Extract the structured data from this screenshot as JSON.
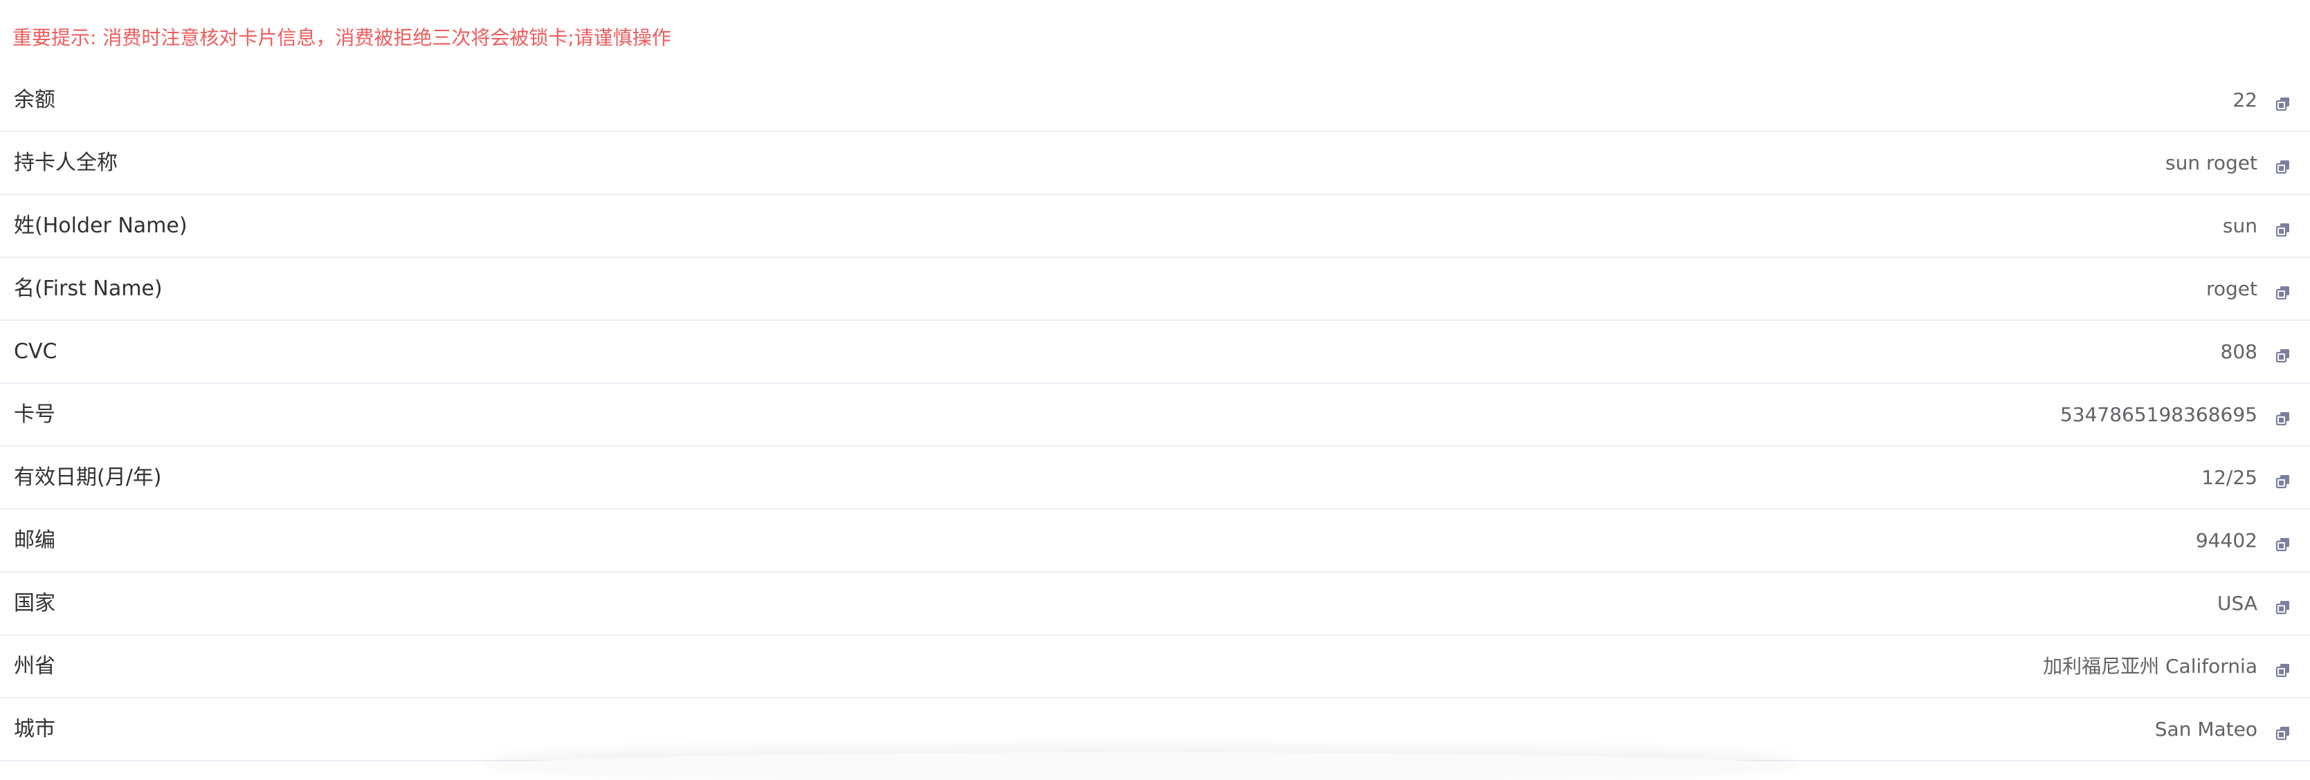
{
  "notice": "重要提示: 消费时注意核对卡片信息，消费被拒绝三次将会被锁卡;请谨慎操作",
  "colors": {
    "notice": "#ee5c5c",
    "label": "#303133",
    "value": "#606266",
    "divider": "#ebeef5",
    "icon": "#7b7f9e"
  },
  "icons": {
    "copy": "copy-icon"
  },
  "rows": [
    {
      "label": "余额",
      "value": "22"
    },
    {
      "label": "持卡人全称",
      "value": "sun roget"
    },
    {
      "label": "姓(Holder Name)",
      "value": "sun"
    },
    {
      "label": "名(First Name)",
      "value": "roget"
    },
    {
      "label": "CVC",
      "value": "808"
    },
    {
      "label": "卡号",
      "value": "5347865198368695"
    },
    {
      "label": "有效日期(月/年)",
      "value": "12/25"
    },
    {
      "label": "邮编",
      "value": "94402"
    },
    {
      "label": "国家",
      "value": "USA"
    },
    {
      "label": "州省",
      "value": "加利福尼亚州 California"
    },
    {
      "label": "城市",
      "value": "San Mateo"
    }
  ]
}
